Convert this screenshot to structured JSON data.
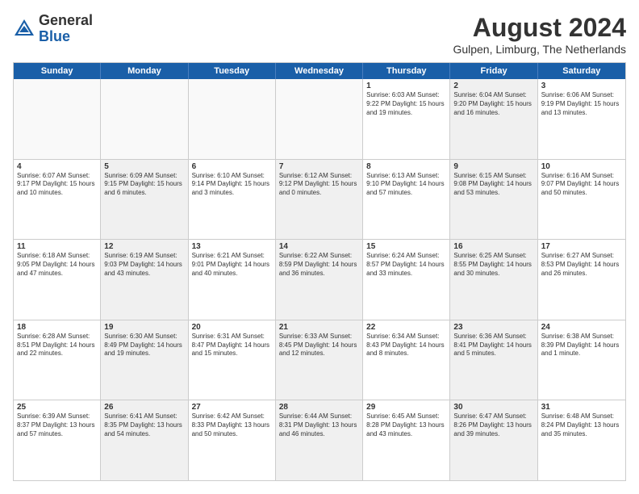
{
  "header": {
    "logo_line1": "General",
    "logo_line2": "Blue",
    "month_year": "August 2024",
    "location": "Gulpen, Limburg, The Netherlands"
  },
  "weekdays": [
    "Sunday",
    "Monday",
    "Tuesday",
    "Wednesday",
    "Thursday",
    "Friday",
    "Saturday"
  ],
  "rows": [
    [
      {
        "day": "",
        "text": "",
        "empty": true
      },
      {
        "day": "",
        "text": "",
        "empty": true
      },
      {
        "day": "",
        "text": "",
        "empty": true
      },
      {
        "day": "",
        "text": "",
        "empty": true
      },
      {
        "day": "1",
        "text": "Sunrise: 6:03 AM\nSunset: 9:22 PM\nDaylight: 15 hours\nand 19 minutes.",
        "empty": false,
        "shaded": false
      },
      {
        "day": "2",
        "text": "Sunrise: 6:04 AM\nSunset: 9:20 PM\nDaylight: 15 hours\nand 16 minutes.",
        "empty": false,
        "shaded": true
      },
      {
        "day": "3",
        "text": "Sunrise: 6:06 AM\nSunset: 9:19 PM\nDaylight: 15 hours\nand 13 minutes.",
        "empty": false,
        "shaded": false
      }
    ],
    [
      {
        "day": "4",
        "text": "Sunrise: 6:07 AM\nSunset: 9:17 PM\nDaylight: 15 hours\nand 10 minutes.",
        "empty": false,
        "shaded": false
      },
      {
        "day": "5",
        "text": "Sunrise: 6:09 AM\nSunset: 9:15 PM\nDaylight: 15 hours\nand 6 minutes.",
        "empty": false,
        "shaded": true
      },
      {
        "day": "6",
        "text": "Sunrise: 6:10 AM\nSunset: 9:14 PM\nDaylight: 15 hours\nand 3 minutes.",
        "empty": false,
        "shaded": false
      },
      {
        "day": "7",
        "text": "Sunrise: 6:12 AM\nSunset: 9:12 PM\nDaylight: 15 hours\nand 0 minutes.",
        "empty": false,
        "shaded": true
      },
      {
        "day": "8",
        "text": "Sunrise: 6:13 AM\nSunset: 9:10 PM\nDaylight: 14 hours\nand 57 minutes.",
        "empty": false,
        "shaded": false
      },
      {
        "day": "9",
        "text": "Sunrise: 6:15 AM\nSunset: 9:08 PM\nDaylight: 14 hours\nand 53 minutes.",
        "empty": false,
        "shaded": true
      },
      {
        "day": "10",
        "text": "Sunrise: 6:16 AM\nSunset: 9:07 PM\nDaylight: 14 hours\nand 50 minutes.",
        "empty": false,
        "shaded": false
      }
    ],
    [
      {
        "day": "11",
        "text": "Sunrise: 6:18 AM\nSunset: 9:05 PM\nDaylight: 14 hours\nand 47 minutes.",
        "empty": false,
        "shaded": false
      },
      {
        "day": "12",
        "text": "Sunrise: 6:19 AM\nSunset: 9:03 PM\nDaylight: 14 hours\nand 43 minutes.",
        "empty": false,
        "shaded": true
      },
      {
        "day": "13",
        "text": "Sunrise: 6:21 AM\nSunset: 9:01 PM\nDaylight: 14 hours\nand 40 minutes.",
        "empty": false,
        "shaded": false
      },
      {
        "day": "14",
        "text": "Sunrise: 6:22 AM\nSunset: 8:59 PM\nDaylight: 14 hours\nand 36 minutes.",
        "empty": false,
        "shaded": true
      },
      {
        "day": "15",
        "text": "Sunrise: 6:24 AM\nSunset: 8:57 PM\nDaylight: 14 hours\nand 33 minutes.",
        "empty": false,
        "shaded": false
      },
      {
        "day": "16",
        "text": "Sunrise: 6:25 AM\nSunset: 8:55 PM\nDaylight: 14 hours\nand 30 minutes.",
        "empty": false,
        "shaded": true
      },
      {
        "day": "17",
        "text": "Sunrise: 6:27 AM\nSunset: 8:53 PM\nDaylight: 14 hours\nand 26 minutes.",
        "empty": false,
        "shaded": false
      }
    ],
    [
      {
        "day": "18",
        "text": "Sunrise: 6:28 AM\nSunset: 8:51 PM\nDaylight: 14 hours\nand 22 minutes.",
        "empty": false,
        "shaded": false
      },
      {
        "day": "19",
        "text": "Sunrise: 6:30 AM\nSunset: 8:49 PM\nDaylight: 14 hours\nand 19 minutes.",
        "empty": false,
        "shaded": true
      },
      {
        "day": "20",
        "text": "Sunrise: 6:31 AM\nSunset: 8:47 PM\nDaylight: 14 hours\nand 15 minutes.",
        "empty": false,
        "shaded": false
      },
      {
        "day": "21",
        "text": "Sunrise: 6:33 AM\nSunset: 8:45 PM\nDaylight: 14 hours\nand 12 minutes.",
        "empty": false,
        "shaded": true
      },
      {
        "day": "22",
        "text": "Sunrise: 6:34 AM\nSunset: 8:43 PM\nDaylight: 14 hours\nand 8 minutes.",
        "empty": false,
        "shaded": false
      },
      {
        "day": "23",
        "text": "Sunrise: 6:36 AM\nSunset: 8:41 PM\nDaylight: 14 hours\nand 5 minutes.",
        "empty": false,
        "shaded": true
      },
      {
        "day": "24",
        "text": "Sunrise: 6:38 AM\nSunset: 8:39 PM\nDaylight: 14 hours\nand 1 minute.",
        "empty": false,
        "shaded": false
      }
    ],
    [
      {
        "day": "25",
        "text": "Sunrise: 6:39 AM\nSunset: 8:37 PM\nDaylight: 13 hours\nand 57 minutes.",
        "empty": false,
        "shaded": false
      },
      {
        "day": "26",
        "text": "Sunrise: 6:41 AM\nSunset: 8:35 PM\nDaylight: 13 hours\nand 54 minutes.",
        "empty": false,
        "shaded": true
      },
      {
        "day": "27",
        "text": "Sunrise: 6:42 AM\nSunset: 8:33 PM\nDaylight: 13 hours\nand 50 minutes.",
        "empty": false,
        "shaded": false
      },
      {
        "day": "28",
        "text": "Sunrise: 6:44 AM\nSunset: 8:31 PM\nDaylight: 13 hours\nand 46 minutes.",
        "empty": false,
        "shaded": true
      },
      {
        "day": "29",
        "text": "Sunrise: 6:45 AM\nSunset: 8:28 PM\nDaylight: 13 hours\nand 43 minutes.",
        "empty": false,
        "shaded": false
      },
      {
        "day": "30",
        "text": "Sunrise: 6:47 AM\nSunset: 8:26 PM\nDaylight: 13 hours\nand 39 minutes.",
        "empty": false,
        "shaded": true
      },
      {
        "day": "31",
        "text": "Sunrise: 6:48 AM\nSunset: 8:24 PM\nDaylight: 13 hours\nand 35 minutes.",
        "empty": false,
        "shaded": false
      }
    ]
  ]
}
